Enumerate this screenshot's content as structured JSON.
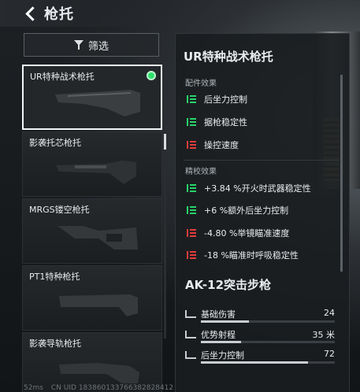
{
  "header": {
    "title": "枪托"
  },
  "filter": {
    "label": "筛选"
  },
  "items": [
    {
      "label": "UR特种战术枪托",
      "selected": true,
      "equipped": true
    },
    {
      "label": "影袭托芯枪托"
    },
    {
      "label": "MRGS镂空枪托"
    },
    {
      "label": "PT1特种枪托"
    },
    {
      "label": "影袭导轨枪托"
    }
  ],
  "detail": {
    "title": "UR特种战术枪托",
    "parts_label": "配件效果",
    "parts": [
      {
        "label": "后坐力控制",
        "dir": "up"
      },
      {
        "label": "据枪稳定性",
        "dir": "up"
      },
      {
        "label": "操控速度",
        "dir": "down"
      }
    ],
    "tuning_label": "精校效果",
    "tuning": [
      {
        "label": "+3.84 %开火时武器稳定性",
        "dir": "up"
      },
      {
        "label": "+6 %额外后坐力控制",
        "dir": "up"
      },
      {
        "label": "-4.80 %举镜瞄准速度",
        "dir": "down"
      },
      {
        "label": "-18 %瞄准时呼吸稳定性",
        "dir": "down"
      }
    ],
    "weapon": "AK-12突击步枪",
    "stats": [
      {
        "name": "基础伤害",
        "value": "24",
        "fill": 0.36
      },
      {
        "name": "优势射程",
        "value": "35 米",
        "fill": 0.3
      },
      {
        "name": "后坐力控制",
        "value": "72",
        "fill": 0.8
      }
    ]
  },
  "footer": {
    "ping": "52ms",
    "uid": "CN UID 183860133766382828412"
  },
  "colors": {
    "up": "#27d36b",
    "down": "#e23c3c",
    "equipped": "#2fe06a"
  }
}
